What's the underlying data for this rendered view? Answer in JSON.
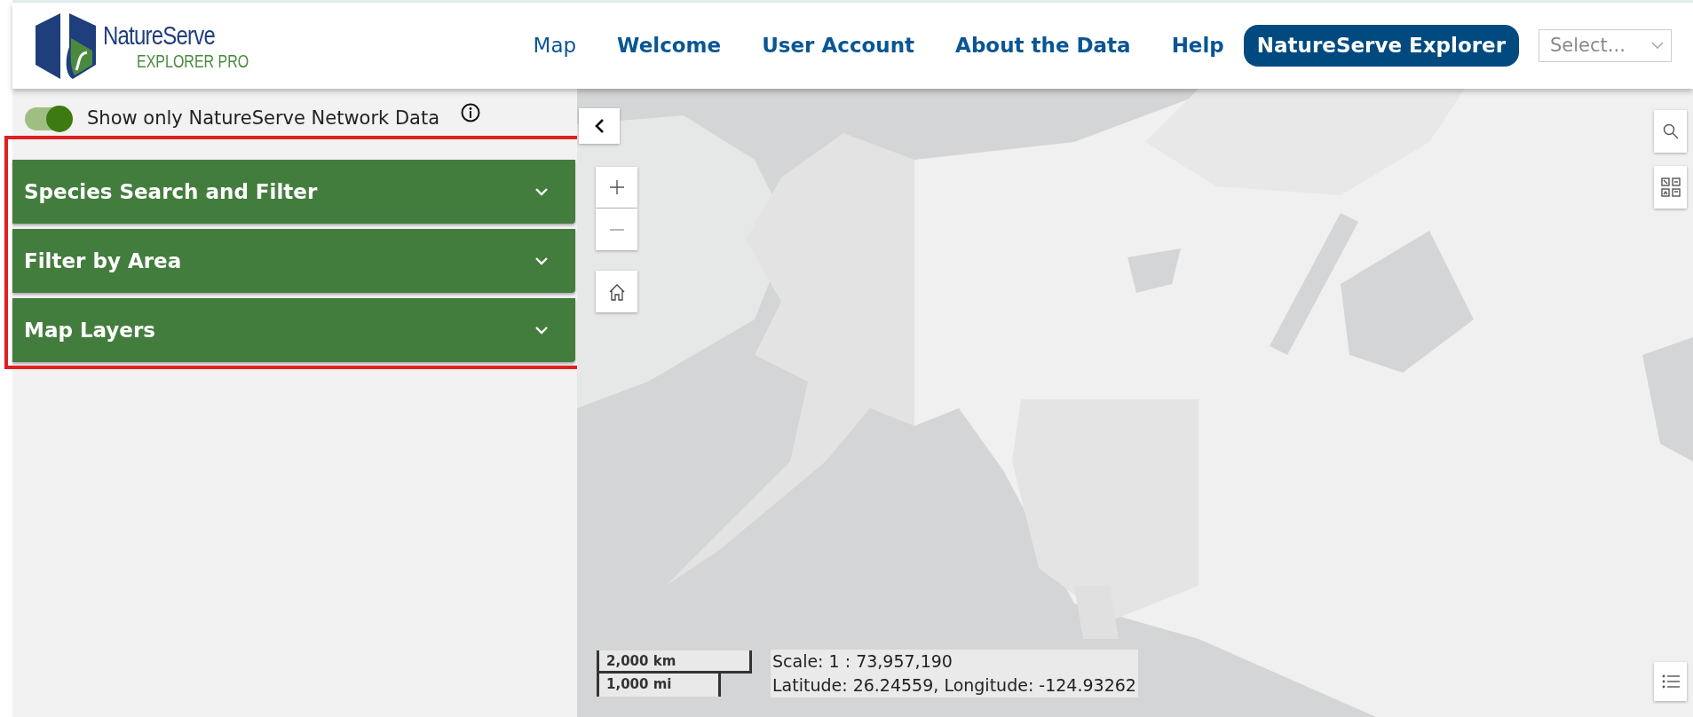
{
  "header": {
    "logo": {
      "name": "NatureServe",
      "subtitle": "EXPLORER PRO"
    },
    "nav": [
      {
        "label": "Map",
        "selected": true
      },
      {
        "label": "Welcome",
        "selected": false
      },
      {
        "label": "User Account",
        "selected": false
      },
      {
        "label": "About the Data",
        "selected": false
      },
      {
        "label": "Help",
        "selected": false
      }
    ],
    "explorer_button": "NatureServe Explorer",
    "select": {
      "placeholder": "Select..."
    }
  },
  "sidebar": {
    "toggle": {
      "label": "Show only NatureServe Network Data",
      "on": true
    },
    "panels": [
      {
        "title": "Species Search and Filter",
        "expanded": false
      },
      {
        "title": "Filter by Area",
        "expanded": false
      },
      {
        "title": "Map Layers",
        "expanded": false
      }
    ]
  },
  "map": {
    "kind": "picture",
    "scale_bar": [
      "2,000 km",
      "1,000 mi"
    ],
    "scale": "Scale: 1 : 73,957,190",
    "coordinates": "Latitude: 26.24559, Longitude: -124.93262"
  }
}
